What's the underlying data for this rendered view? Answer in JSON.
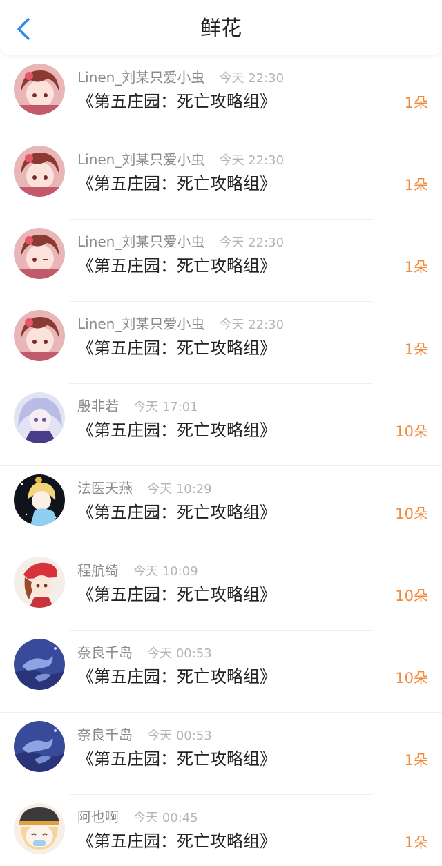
{
  "header": {
    "title": "鲜花",
    "back_icon": "chevron-left-icon",
    "accent_color": "#2a8de8"
  },
  "colors": {
    "count": "#f08a3c",
    "name": "#8a8a8a",
    "time": "#b4b4b4"
  },
  "gifts": [
    {
      "user": "Linen_刘某只爱小虫",
      "time": "今天 22:30",
      "title": "《第五庄园：死亡攻略组》",
      "count": "1朵",
      "avatar": "pink-hair-girl-avatar"
    },
    {
      "user": "Linen_刘某只爱小虫",
      "time": "今天 22:30",
      "title": "《第五庄园：死亡攻略组》",
      "count": "1朵",
      "avatar": "pink-hair-girl-avatar"
    },
    {
      "user": "Linen_刘某只爱小虫",
      "time": "今天 22:30",
      "title": "《第五庄园：死亡攻略组》",
      "count": "1朵",
      "avatar": "pink-hair-girl-avatar"
    },
    {
      "user": "Linen_刘某只爱小虫",
      "time": "今天 22:30",
      "title": "《第五庄园：死亡攻略组》",
      "count": "1朵",
      "avatar": "pink-hair-girl-avatar"
    },
    {
      "user": "殷非若",
      "time": "今天 17:01",
      "title": "《第五庄园：死亡攻略组》",
      "count": "10朵",
      "avatar": "lavender-hair-avatar"
    },
    {
      "user": "法医天燕",
      "time": "今天 10:29",
      "title": "《第五庄园：死亡攻略组》",
      "count": "10朵",
      "avatar": "blonde-night-avatar"
    },
    {
      "user": "程航绮",
      "time": "今天 10:09",
      "title": "《第五庄园：死亡攻略组》",
      "count": "10朵",
      "avatar": "red-hat-avatar"
    },
    {
      "user": "奈良千岛",
      "time": "今天 00:53",
      "title": "《第五庄园：死亡攻略组》",
      "count": "10朵",
      "avatar": "blue-dolphin-avatar"
    },
    {
      "user": "奈良千岛",
      "time": "今天 00:53",
      "title": "《第五庄园：死亡攻略组》",
      "count": "1朵",
      "avatar": "blue-dolphin-avatar"
    },
    {
      "user": "阿也啊",
      "time": "今天 00:45",
      "title": "《第五庄园：死亡攻略组》",
      "count": "1朵",
      "avatar": "chibi-cap-avatar"
    }
  ]
}
